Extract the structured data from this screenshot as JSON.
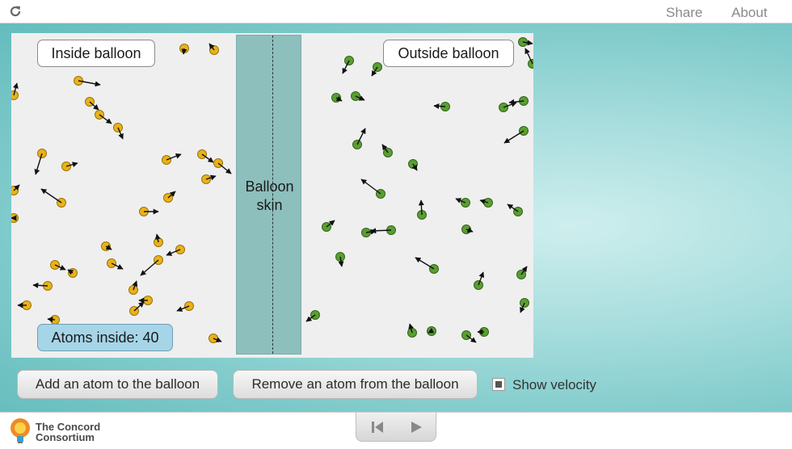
{
  "header": {
    "share_label": "Share",
    "about_label": "About"
  },
  "simulation": {
    "inside_label": "Inside balloon",
    "outside_label": "Outside balloon",
    "skin_label": "Balloon\nskin",
    "atoms_inside_text": "Atoms inside: 40",
    "inside_atom_color": "#e8b21a",
    "outside_atom_color": "#5a9e32"
  },
  "controls": {
    "add_button": "Add an atom to the balloon",
    "remove_button": "Remove an atom from the balloon",
    "show_velocity_label": "Show velocity",
    "show_velocity_checked": true
  },
  "footer": {
    "logo_line1": "The Concord",
    "logo_line2": "Consortium"
  }
}
